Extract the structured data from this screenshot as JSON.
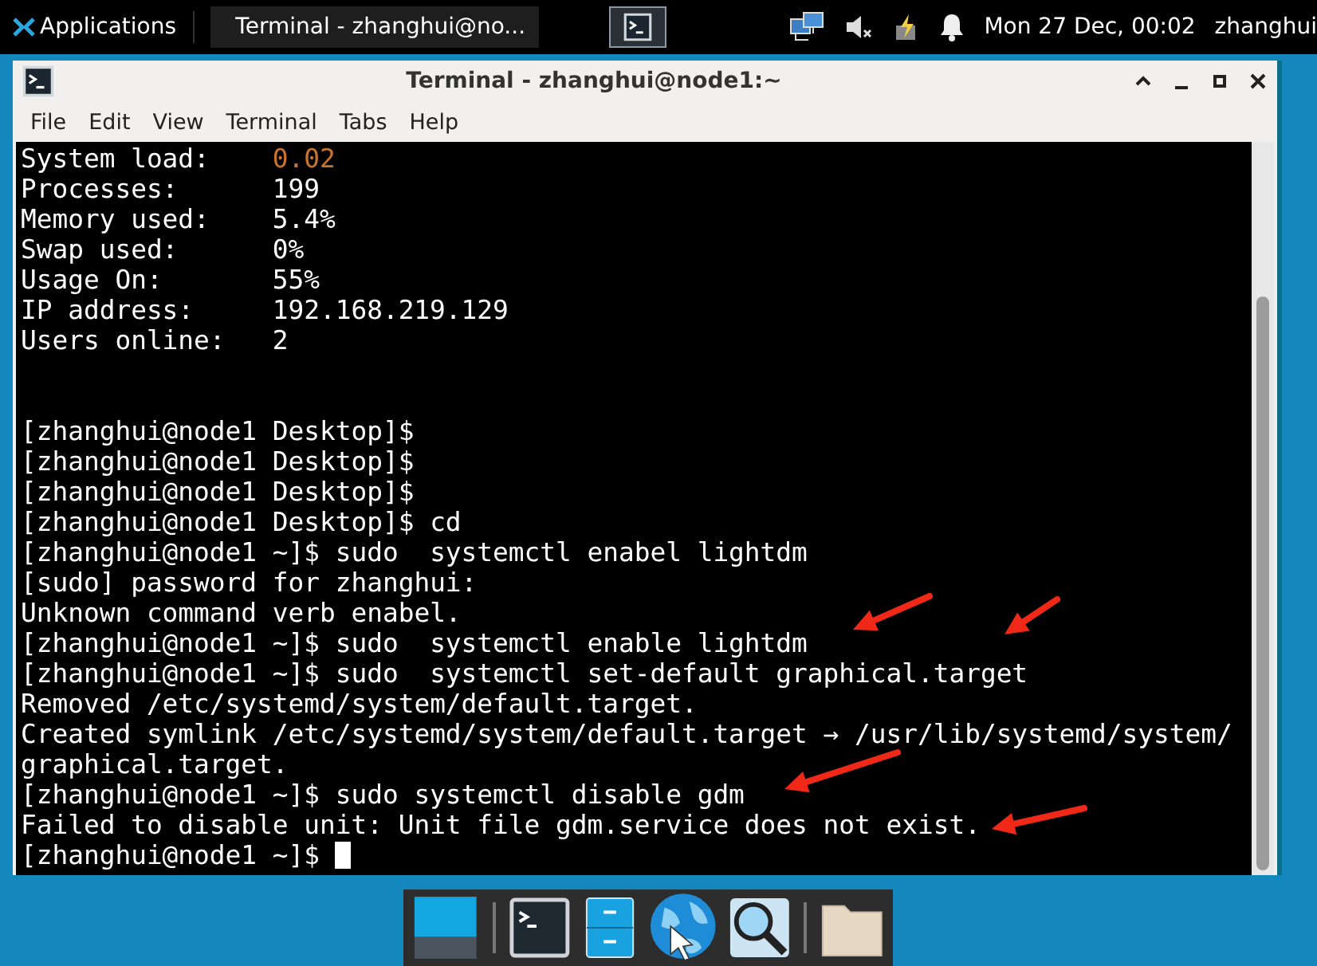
{
  "top_panel": {
    "applications": "Applications",
    "tasks": [
      {
        "title": "Terminal - zhanghui@no...",
        "selected": false
      }
    ],
    "clock": "Mon 27 Dec, 00:02",
    "user": "zhanghui"
  },
  "window": {
    "title": "Terminal - zhanghui@node1:~",
    "menu": [
      "File",
      "Edit",
      "View",
      "Terminal",
      "Tabs",
      "Help"
    ]
  },
  "terminal": {
    "info": [
      {
        "label": "System load:",
        "value": "0.02",
        "color": "#c8742e"
      },
      {
        "label": "Processes:",
        "value": "199",
        "color": "#ffffff"
      },
      {
        "label": "Memory used:",
        "value": "5.4%",
        "color": "#ffffff"
      },
      {
        "label": "Swap used:",
        "value": "0%",
        "color": "#ffffff"
      },
      {
        "label": "Usage On:",
        "value": "55%",
        "color": "#ffffff"
      },
      {
        "label": "IP address:",
        "value": "192.168.219.129",
        "color": "#ffffff"
      },
      {
        "label": "Users online:",
        "value": "2",
        "color": "#ffffff"
      }
    ],
    "lines": [
      "[zhanghui@node1 Desktop]$",
      "[zhanghui@node1 Desktop]$",
      "[zhanghui@node1 Desktop]$",
      "[zhanghui@node1 Desktop]$ cd",
      "[zhanghui@node1 ~]$ sudo  systemctl enabel lightdm",
      "[sudo] password for zhanghui:",
      "Unknown command verb enabel.",
      "[zhanghui@node1 ~]$ sudo  systemctl enable lightdm",
      "[zhanghui@node1 ~]$ sudo  systemctl set-default graphical.target",
      "Removed /etc/systemd/system/default.target.",
      "Created symlink /etc/systemd/system/default.target → /usr/lib/systemd/system/",
      "graphical.target.",
      "[zhanghui@node1 ~]$ sudo systemctl disable gdm",
      "Failed to disable unit: Unit file gdm.service does not exist."
    ],
    "prompt": "[zhanghui@node1 ~]$ "
  }
}
